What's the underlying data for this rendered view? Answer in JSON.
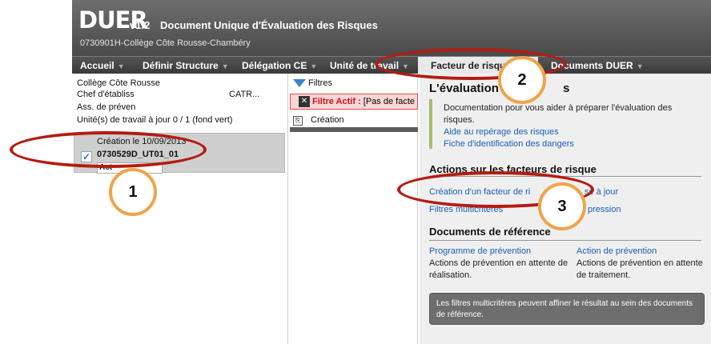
{
  "header": {
    "app_name": "DUER",
    "version": "v1.2",
    "subtitle": "Document Unique d'Évaluation des Risques",
    "school": "0730901H-Collège Côte Rousse-Chambéry"
  },
  "menu": {
    "items": [
      {
        "label": "Accueil"
      },
      {
        "label": "Définir Structure"
      },
      {
        "label": "Délégation CE"
      },
      {
        "label": "Unité de travail"
      },
      {
        "label": "Facteur de risque"
      },
      {
        "label": "Documents DUER"
      }
    ]
  },
  "left_panel": {
    "lines": [
      "Collège Côte Rousse",
      "Chef d'établiss",
      "CATR...",
      "Ass. de préven",
      "Unité(s) de travail à jour 0 / 1 (fond vert)"
    ],
    "item": {
      "check": "✓",
      "date_label": "Création le 10/09/2013",
      "code": "0730529D_UT01_01",
      "button_label": "Act"
    }
  },
  "middle_panel": {
    "filters_label": "Filtres",
    "active_filter_prefix": "Filtre Actif :",
    "active_filter_value": "[Pas de facte",
    "creation_label": "Création"
  },
  "right_panel": {
    "title": "L'évaluation",
    "title_end": "s",
    "doc_text": "Documentation pour vous aider à préparer l'évaluation des risques.",
    "links": [
      "Aide au repérage des risques",
      "Fiche d'identification des dangers"
    ],
    "actions_title": "Actions sur les facteurs de risque",
    "action_create": "Création d'un facteur de ri",
    "action_update": "se à jour",
    "action_filters": "Filtres multicritères",
    "action_print": "pression",
    "references_title": "Documents de référence",
    "ref_left": {
      "link": "Programme de prévention",
      "text": "Actions de prévention en attente de réalisation."
    },
    "ref_right": {
      "link": "Action de prévention",
      "text": "Actions de prévention en attente de traitement."
    },
    "tip": "Les filtres multicritères peuvent affiner le résultat au sein des documents de référence."
  },
  "annotations": {
    "bubble1": "1",
    "bubble2": "2",
    "bubble3": "3"
  },
  "colors": {
    "annotation_ellipse": "#b31c12",
    "annotation_bubble_border": "#f0a44a",
    "link": "#1a5fb4",
    "active_filter_bg": "#fbd7d7"
  }
}
